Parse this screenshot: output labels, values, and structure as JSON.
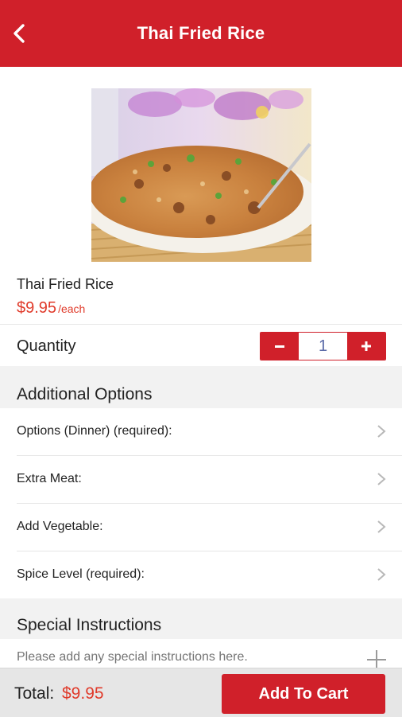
{
  "header": {
    "title": "Thai Fried Rice",
    "back_icon": "chevron-left-icon"
  },
  "colors": {
    "brand": "#d0202a",
    "price": "#e03a2a",
    "background_gray": "#f2f2f2"
  },
  "item": {
    "name": "Thai Fried Rice",
    "price": "$9.95",
    "price_unit": "/each"
  },
  "quantity": {
    "label": "Quantity",
    "value": "1",
    "minus": "−",
    "plus": "+"
  },
  "additional_options": {
    "title": "Additional Options",
    "items": [
      {
        "label": "Options (Dinner) (required):"
      },
      {
        "label": "Extra Meat:"
      },
      {
        "label": "Add Vegetable:"
      },
      {
        "label": "Spice Level (required):"
      }
    ]
  },
  "special_instructions": {
    "title": "Special Instructions",
    "placeholder": "Please add any special instructions here."
  },
  "footer": {
    "total_label": "Total:",
    "total_value": "$9.95",
    "add_to_cart": "Add To Cart"
  }
}
